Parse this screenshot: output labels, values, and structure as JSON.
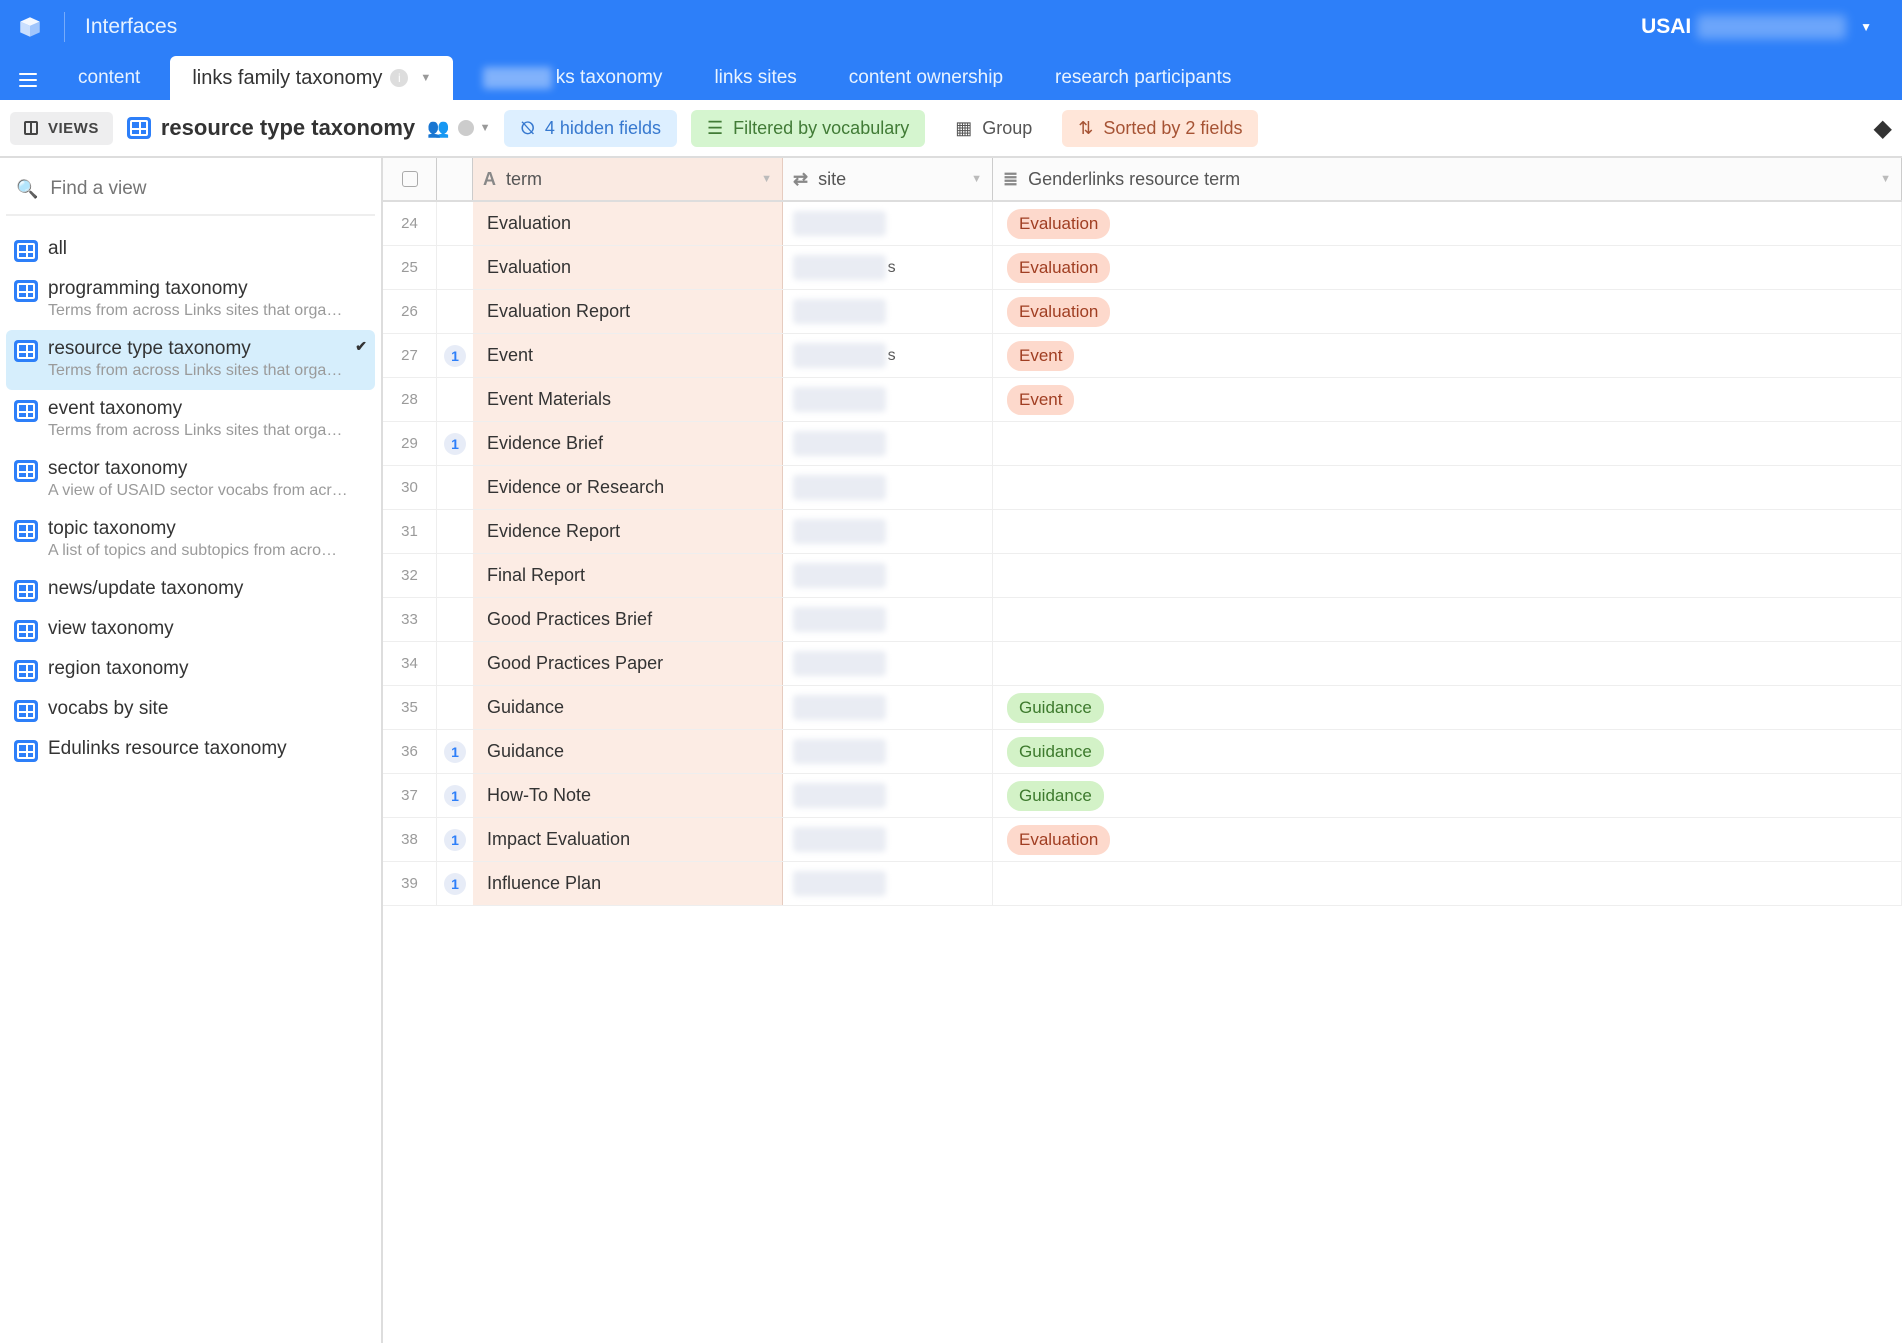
{
  "topbar": {
    "brand": "Interfaces",
    "workspace_prefix": "USAI"
  },
  "tabs": {
    "items": [
      {
        "label": "content"
      },
      {
        "label": "links family taxonomy",
        "active": true
      },
      {
        "label_suffix": "ks taxonomy",
        "blurred_prefix": true
      },
      {
        "label": "links sites"
      },
      {
        "label": "content ownership"
      },
      {
        "label": "research participants"
      }
    ]
  },
  "toolbar": {
    "views_label": "VIEWS",
    "view_name": "resource type taxonomy",
    "hidden_fields": "4 hidden fields",
    "filtered": "Filtered by vocabulary",
    "group": "Group",
    "sorted": "Sorted by 2 fields"
  },
  "sidebar": {
    "search_placeholder": "Find a view",
    "views": [
      {
        "name": "all"
      },
      {
        "name": "programming taxonomy",
        "desc": "Terms from across Links sites that orga…"
      },
      {
        "name": "resource type taxonomy",
        "desc": "Terms from across Links sites that orga…",
        "selected": true
      },
      {
        "name": "event taxonomy",
        "desc": "Terms from across Links sites that orga…"
      },
      {
        "name": "sector taxonomy",
        "desc": "A view of USAID sector vocabs from acr…"
      },
      {
        "name": "topic taxonomy",
        "desc": "A list of topics and subtopics from acro…"
      },
      {
        "name": "news/update taxonomy"
      },
      {
        "name": "view taxonomy"
      },
      {
        "name": "region taxonomy"
      },
      {
        "name": "vocabs by site"
      },
      {
        "name": "Edulinks resource taxonomy"
      }
    ]
  },
  "grid": {
    "columns": {
      "term": "term",
      "site": "site",
      "gl": "Genderlinks resource term"
    },
    "rows": [
      {
        "n": "24",
        "term": "Evaluation",
        "gl": "Evaluation",
        "gl_kind": "eval"
      },
      {
        "n": "25",
        "term": "Evaluation",
        "site_suffix": "s",
        "gl": "Evaluation",
        "gl_kind": "eval"
      },
      {
        "n": "26",
        "term": "Evaluation Report",
        "gl": "Evaluation",
        "gl_kind": "eval"
      },
      {
        "n": "27",
        "term": "Event",
        "badge": "1",
        "site_suffix": "s",
        "gl": "Event",
        "gl_kind": "event"
      },
      {
        "n": "28",
        "term": "Event Materials",
        "gl": "Event",
        "gl_kind": "event"
      },
      {
        "n": "29",
        "term": "Evidence Brief",
        "badge": "1"
      },
      {
        "n": "30",
        "term": "Evidence or Research"
      },
      {
        "n": "31",
        "term": "Evidence Report"
      },
      {
        "n": "32",
        "term": "Final Report"
      },
      {
        "n": "33",
        "term": "Good Practices Brief"
      },
      {
        "n": "34",
        "term": "Good Practices Paper"
      },
      {
        "n": "35",
        "term": "Guidance",
        "gl": "Guidance",
        "gl_kind": "guide"
      },
      {
        "n": "36",
        "term": "Guidance",
        "badge": "1",
        "gl": "Guidance",
        "gl_kind": "guide"
      },
      {
        "n": "37",
        "term": "How-To Note",
        "badge": "1",
        "gl": "Guidance",
        "gl_kind": "guide"
      },
      {
        "n": "38",
        "term": "Impact Evaluation",
        "badge": "1",
        "gl": "Evaluation",
        "gl_kind": "eval"
      },
      {
        "n": "39",
        "term": "Influence Plan",
        "badge": "1"
      }
    ]
  }
}
